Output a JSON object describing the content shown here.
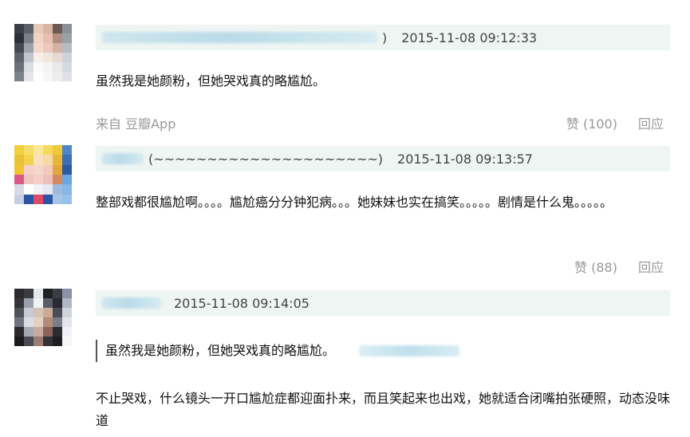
{
  "comments": [
    {
      "meta_visible": ")",
      "time": "2015-11-08 09:12:33",
      "text": "虽然我是她颜粉，但她哭戏真的略尴尬。",
      "source": "来自 豆瓣App",
      "like": "赞 (100)",
      "reply": "回应"
    },
    {
      "meta_visible": "(~~~~~~~~~~~~~~~~~~~~~)",
      "time": "2015-11-08 09:13:57",
      "text": "整部戏都很尴尬啊。。。。尴尬癌分分钟犯病。。。她妹妹也实在搞笑。。。。。剧情是什么鬼。。。。。",
      "like": "赞 (88)",
      "reply": "回应"
    },
    {
      "time": "2015-11-08 09:14:05",
      "quote": "虽然我是她颜粉，但她哭戏真的略尴尬。",
      "text": "不止哭戏，什么镜头一开口尴尬症都迎面扑来，而且笑起来也出戏，她就适合闭嘴拍张硬照，动态没味道"
    }
  ]
}
